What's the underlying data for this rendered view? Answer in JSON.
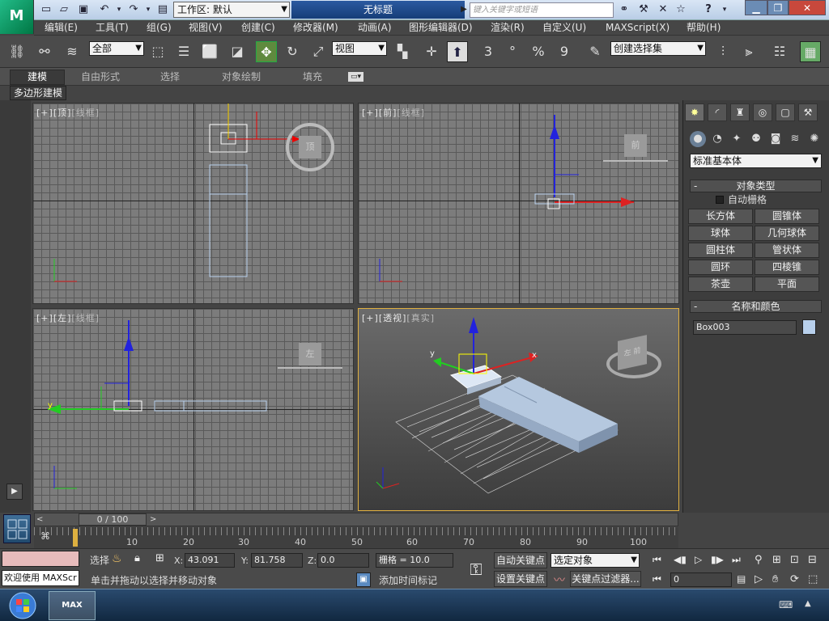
{
  "app": {
    "logo": "M",
    "workspace_label": "工作区: 默认",
    "doc_title": "无标题",
    "search_placeholder": "键入关键字或短语",
    "icons": [
      "new-icon",
      "open-icon",
      "save-icon",
      "undo-icon",
      "redo-icon",
      "project-folder-icon",
      "binoculars-icon",
      "tools-icon",
      "star-icon",
      "help-icon"
    ]
  },
  "menu": [
    "编辑(E)",
    "工具(T)",
    "组(G)",
    "视图(V)",
    "创建(C)",
    "修改器(M)",
    "动画(A)",
    "图形编辑器(D)",
    "渲染(R)",
    "自定义(U)",
    "MAXScript(X)",
    "帮助(H)"
  ],
  "toolbar": {
    "filter_value": "全部",
    "ref_coord_value": "视图",
    "snap_label": "3",
    "angle_snap": "°",
    "percent_snap": "%",
    "spinner_snap": "9",
    "named_selection_value": "创建选择集"
  },
  "ribbon": {
    "tabs": [
      "建模",
      "自由形式",
      "选择",
      "对象绘制",
      "填充"
    ],
    "sub_label": "多边形建模"
  },
  "viewports": [
    {
      "label_plus": "[+]",
      "label_name": "[顶]",
      "label_shade": "[线框]"
    },
    {
      "label_plus": "[+]",
      "label_name": "[前]",
      "label_shade": "[线框]"
    },
    {
      "label_plus": "[+]",
      "label_name": "[左]",
      "label_shade": "[线框]"
    },
    {
      "label_plus": "[+]",
      "label_name": "[透视]",
      "label_shade": "[真实]"
    }
  ],
  "viewcube": {
    "top": "顶",
    "front": "前",
    "left": "左",
    "persp": "左 前"
  },
  "axis": {
    "x": "x",
    "y": "y",
    "z": "z"
  },
  "command_panel": {
    "category_value": "标准基本体",
    "object_type_title": "对象类型",
    "autogrid_label": "自动栅格",
    "buttons": [
      "长方体",
      "圆锥体",
      "球体",
      "几何球体",
      "圆柱体",
      "管状体",
      "圆环",
      "四棱锥",
      "茶壶",
      "平面"
    ],
    "name_color_title": "名称和颜色",
    "object_name": "Box003",
    "object_color": "#b8d0ec"
  },
  "timeslider": {
    "position": "0 / 100",
    "ticks": [
      "10",
      "20",
      "30",
      "40",
      "50",
      "60",
      "70",
      "80",
      "90",
      "100"
    ]
  },
  "status": {
    "welcome": "欢迎使用 MAXScr",
    "select_label": "选择",
    "x_label": "X:",
    "x_value": "43.091",
    "y_label": "Y:",
    "y_value": "81.758",
    "z_label": "Z:",
    "z_value": "0.0",
    "grid_text": "栅格 = 10.0",
    "prompt": "单击并拖动以选择并移动对象",
    "add_time_tag": "添加时间标记",
    "auto_key": "自动关键点",
    "set_key": "设置关键点",
    "selected_object": "选定对象",
    "key_filters": "关键点过滤器...",
    "frame_value": "0"
  }
}
